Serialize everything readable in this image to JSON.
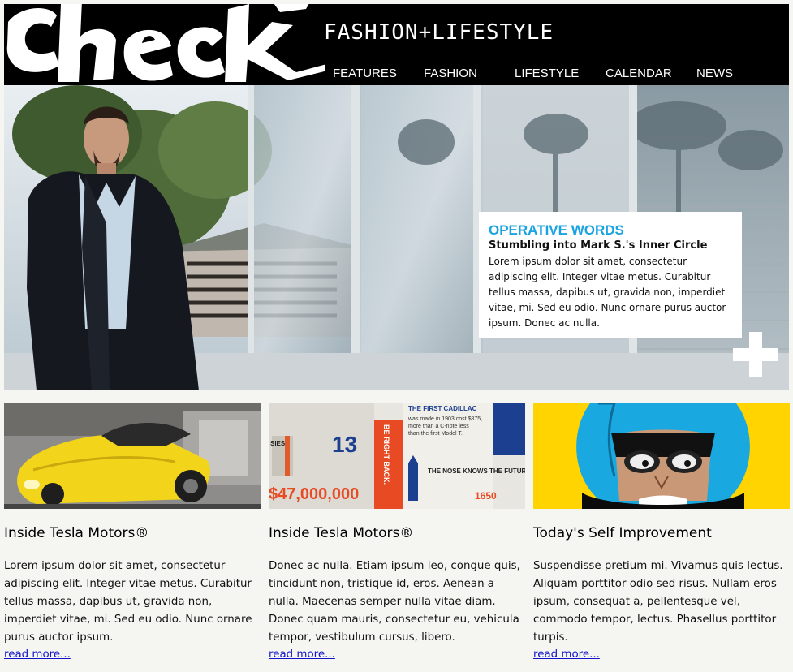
{
  "header": {
    "logo_text": "check",
    "tagline": "FASHION+LIFESTYLE"
  },
  "nav": {
    "items": [
      {
        "label": "FEATURES"
      },
      {
        "label": "FASHION"
      },
      {
        "label": "LIFESTYLE"
      },
      {
        "label": "CALENDAR"
      },
      {
        "label": "NEWS"
      }
    ]
  },
  "feature": {
    "kicker": "OPERATIVE WORDS",
    "title": "Stumbling into Mark S.'s Inner Circle",
    "text": "Lorem ipsum dolor sit amet, consectetur adipiscing elit. Integer vitae metus. Curabitur tellus massa, dapibus ut, gravida non, imperdiet vitae, mi. Sed eu odio. Nunc ornare purus auctor ipsum. Donec ac nulla."
  },
  "cards": [
    {
      "title": "Inside Tesla Motors®",
      "body": "Lorem ipsum dolor sit amet, consectetur adipiscing elit. Integer vitae metus. Curabitur tellus massa, dapibus ut, gravida non, imperdiet vitae, mi. Sed eu odio. Nunc ornare purus auctor ipsum.",
      "link": "read more..."
    },
    {
      "title": "Inside Tesla Motors®",
      "body": "Donec ac nulla. Etiam ipsum leo, congue quis, tincidunt non, tristique id, eros. Aenean a nulla. Maecenas semper nulla vitae diam. Donec quam mauris, consectetur eu, vehicula tempor, vestibulum cursus, libero.",
      "link": "read more...",
      "infographic": {
        "heading1": "THE FIRST CADILLAC",
        "text1": "was made in 1903 cost $875, more than a C-note less than the first Model T.",
        "heading2": "THE NOSE KNOWS THE FUTURE",
        "number": "1650",
        "big_number": "13",
        "quote": "BE RIGHT BACK.",
        "money": "$47,000,000",
        "side": "SIES"
      }
    },
    {
      "title": "Today's Self Improvement",
      "body": "Suspendisse pretium mi. Vivamus quis lectus. Aliquam porttitor odio sed risus. Nullam eros ipsum, consequat a, pellentesque vel, commodo tempor, lectus. Phasellus porttitor turpis.",
      "link": "read more..."
    }
  ],
  "colors": {
    "header_bg": "#000000",
    "accent_blue": "#1aa3e0",
    "link": "#1212c8",
    "tesla_yellow": "#f2d41a",
    "helmet_blue": "#1aa8e0",
    "bg_yellow": "#ffd400"
  }
}
